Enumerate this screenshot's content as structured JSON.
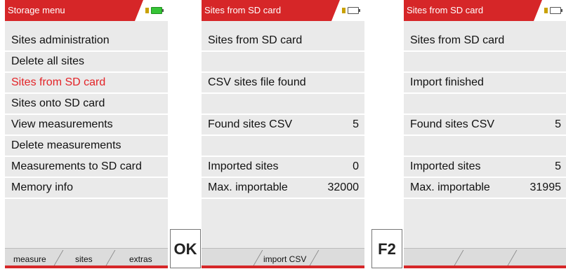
{
  "screens": [
    {
      "title": "Storage menu",
      "battery_state": "charging-full",
      "rows": [
        {
          "label": "Sites administration",
          "value": ""
        },
        {
          "label": "Delete all sites",
          "value": ""
        },
        {
          "label": "Sites from SD card",
          "value": "",
          "selected": true
        },
        {
          "label": "Sites onto SD card",
          "value": ""
        },
        {
          "label": "View measurements",
          "value": ""
        },
        {
          "label": "Delete measurements",
          "value": ""
        },
        {
          "label": "Measurements to SD card",
          "value": ""
        },
        {
          "label": "Memory info",
          "value": ""
        }
      ],
      "softkeys": [
        "measure",
        "sites",
        "extras"
      ]
    },
    {
      "title": "Sites from SD card",
      "rows": [
        {
          "label": "Sites from SD card",
          "value": ""
        },
        {
          "label": "",
          "value": ""
        },
        {
          "label": "CSV sites file found",
          "value": ""
        },
        {
          "label": "",
          "value": ""
        },
        {
          "label": "Found sites CSV",
          "value": "5"
        },
        {
          "label": "",
          "value": ""
        },
        {
          "label": "Imported sites",
          "value": "0"
        },
        {
          "label": "Max. importable",
          "value": "32000"
        }
      ],
      "softkeys": [
        "import CSV"
      ]
    },
    {
      "title": "Sites from SD card",
      "rows": [
        {
          "label": "Sites from SD card",
          "value": ""
        },
        {
          "label": "",
          "value": ""
        },
        {
          "label": "Import finished",
          "value": ""
        },
        {
          "label": "",
          "value": ""
        },
        {
          "label": "Found sites CSV",
          "value": "5"
        },
        {
          "label": "",
          "value": ""
        },
        {
          "label": "Imported sites",
          "value": "5"
        },
        {
          "label": "Max. importable",
          "value": "31995"
        }
      ],
      "softkeys": []
    }
  ],
  "keys": [
    "OK",
    "F2"
  ],
  "colors": {
    "accent": "#d62628",
    "selected_text": "#e32327",
    "screen_bg": "#eaeaea"
  }
}
